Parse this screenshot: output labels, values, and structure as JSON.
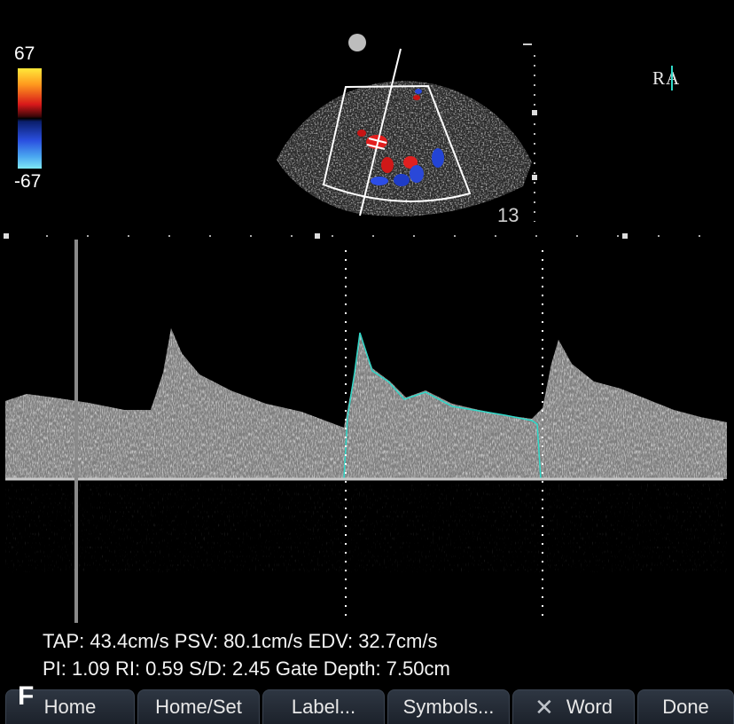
{
  "color_scale": {
    "max_label": "67",
    "min_label": "-67"
  },
  "orientation_label": "RA",
  "depth_label": "13",
  "measurements": {
    "line1": "TAP: 43.4cm/s PSV: 80.1cm/s EDV: 32.7cm/s",
    "line2": "PI: 1.09 RI: 0.59 S/D: 2.45 Gate Depth: 7.50cm"
  },
  "panel_letter": "F",
  "softkeys": [
    {
      "label": "Home"
    },
    {
      "label": "Home/Set"
    },
    {
      "label": "Label..."
    },
    {
      "label": "Symbols..."
    },
    {
      "label": "Word",
      "icon": "x-icon"
    },
    {
      "label": "Done"
    }
  ],
  "colors": {
    "trace": "#2fd8c8",
    "baseline": "#c8c8c8",
    "softkey_bg": "#232a33"
  }
}
